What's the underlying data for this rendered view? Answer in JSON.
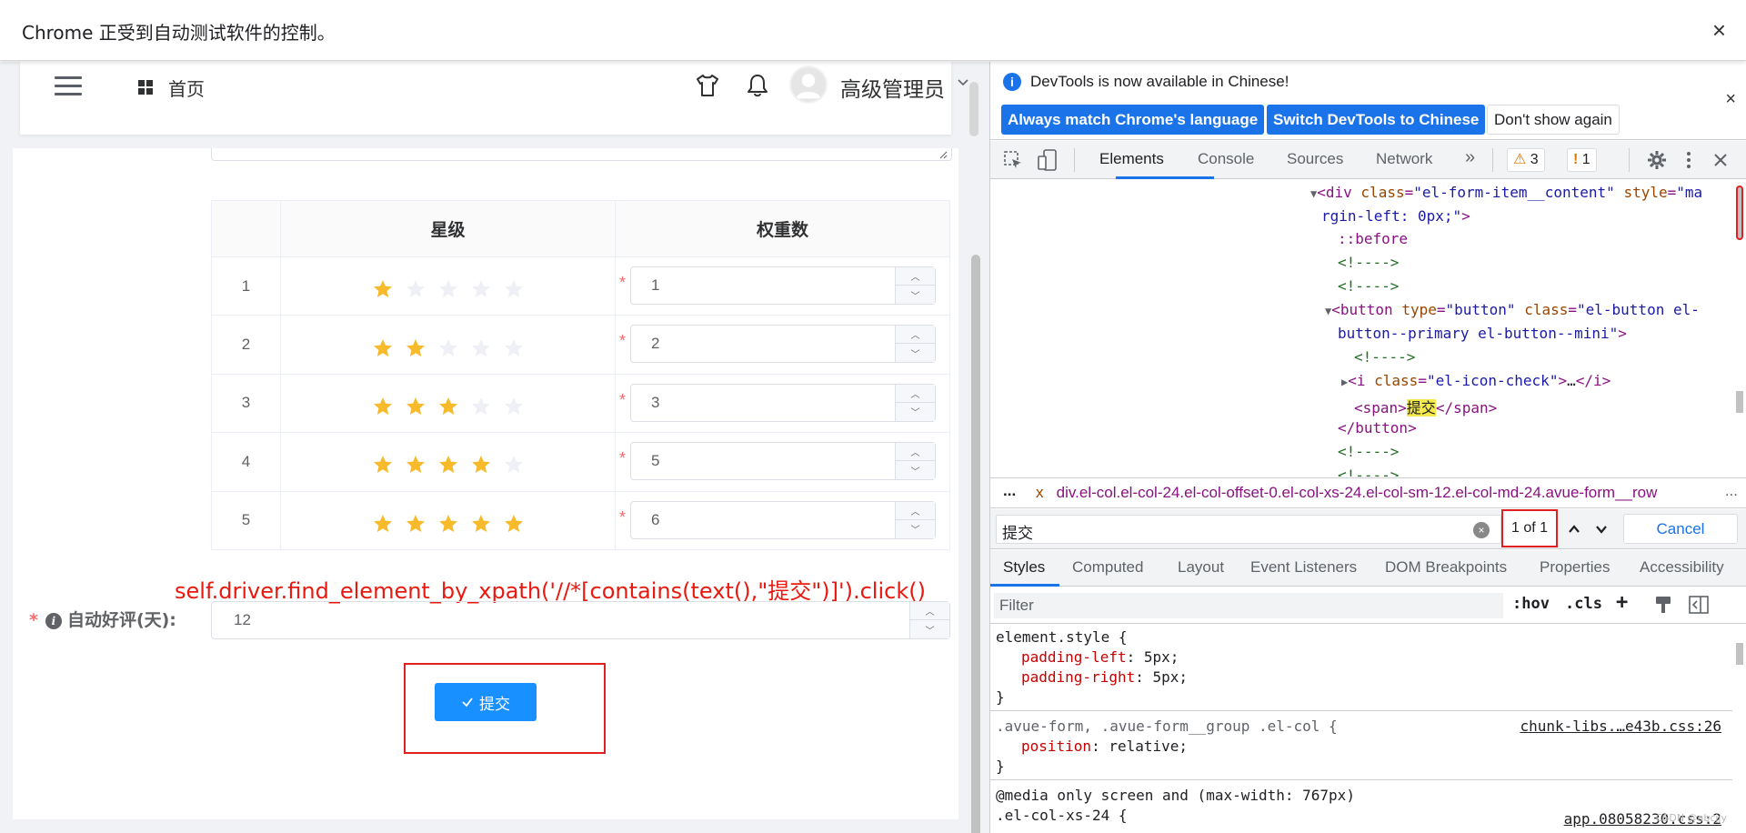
{
  "infobar": {
    "text": "Chrome 正受到自动测试软件的控制。",
    "close": "×"
  },
  "nav": {
    "home": "首页",
    "user": "高级管理员"
  },
  "table": {
    "headers": [
      "",
      "星级",
      "权重数"
    ],
    "rows": [
      {
        "index": "1",
        "stars": 1,
        "weight": "1"
      },
      {
        "index": "2",
        "stars": 2,
        "weight": "2"
      },
      {
        "index": "3",
        "stars": 3,
        "weight": "3"
      },
      {
        "index": "4",
        "stars": 4,
        "weight": "5"
      },
      {
        "index": "5",
        "stars": 5,
        "weight": "6"
      }
    ],
    "required_mark": "*"
  },
  "annotation": "self.driver.find_element_by_xpath('//*[contains(text(),\"提交\")]').click()",
  "auto_review": {
    "required": "*",
    "label": "自动好评(天):",
    "value": "12"
  },
  "submit": {
    "label": "提交"
  },
  "devtools": {
    "banner": {
      "text": "DevTools is now available in Chinese!",
      "btn_match": "Always match Chrome's language",
      "btn_switch": "Switch DevTools to Chinese",
      "btn_dismiss": "Don't show again",
      "close": "×"
    },
    "tabs": [
      "Elements",
      "Console",
      "Sources",
      "Network"
    ],
    "more_tabs": "»",
    "warnings": "3",
    "issues": "1",
    "dom": {
      "div_tag": "div",
      "div_class_attr": "class",
      "div_class_val": "\"el-form-item__content\"",
      "div_style_attr": "style",
      "div_style_val1": "\"ma",
      "div_style_val2": "rgin-left: 0px;\"",
      "before": "::before",
      "comment": "<!---->",
      "button_type_val": "\"button\"",
      "button_class_val1": "\"el-button el-",
      "button_class_val2": "button--primary el-button--mini\"",
      "i_class_val": "\"el-icon-check\"",
      "span_text": "提交"
    },
    "breadcrumb": {
      "dots": "...",
      "x": "x",
      "path": "div.el-col.el-col-24.el-col-offset-0.el-col-xs-24.el-col-sm-12.el-col-md-24.avue-form__row",
      "more": "..."
    },
    "search": {
      "query": "提交",
      "count": "1 of 1",
      "cancel": "Cancel"
    },
    "subtabs": [
      "Styles",
      "Computed",
      "Layout",
      "Event Listeners",
      "DOM Breakpoints",
      "Properties",
      "Accessibility"
    ],
    "filter": {
      "placeholder": "Filter",
      "hov": ":hov",
      "cls": ".cls",
      "plus": "+"
    },
    "styles": {
      "element_style": "element.style {",
      "pl_name": "padding-left",
      "pl_val": "5px;",
      "pr_name": "padding-right",
      "pr_val": "5px;",
      "close": "}",
      "rule2_sel": ".avue-form, .avue-form__group .el-col {",
      "rule2_src": "chunk-libs.…e43b.css:26",
      "pos_name": "position",
      "pos_val": "relative;",
      "media": "@media",
      "media_rest": " only screen and (max-width: 767px)",
      "rule3_sel": ".el-col-xs-24 {",
      "rule3_src": "app.08058230.css:2"
    },
    "watermark": "CSDN @abcjjy"
  },
  "colors": {
    "accent": "#1890ff",
    "devtools_blue": "#1a73e8",
    "star_on": "#f7ba2a",
    "annotation_red": "#e8190f"
  }
}
